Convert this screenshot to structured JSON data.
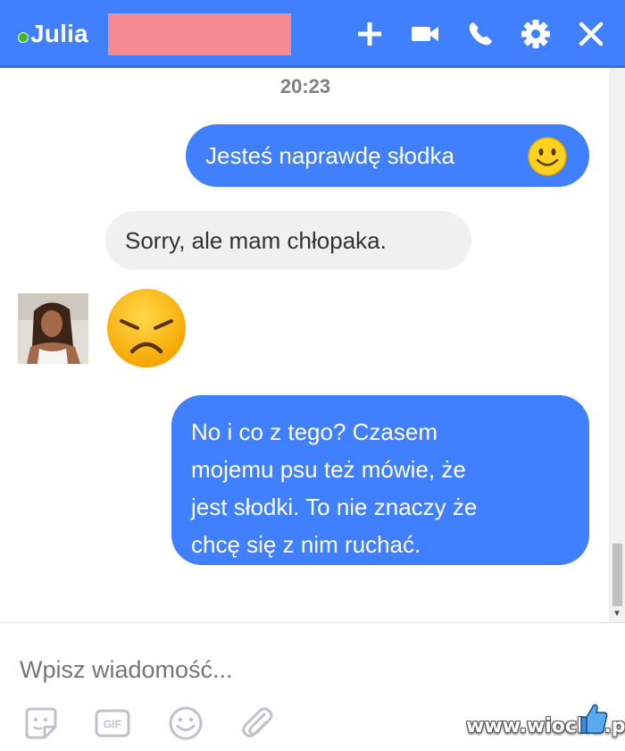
{
  "header": {
    "name": "Julia",
    "status_color": "#42b72a",
    "background": "#4080ff",
    "icons": [
      "plus-icon",
      "video-camera-icon",
      "phone-icon",
      "gear-icon",
      "close-icon"
    ]
  },
  "chat": {
    "timestamp": "20:23",
    "messages": [
      {
        "direction": "outgoing",
        "text": "Jesteś naprawdę słodka",
        "emoji": "smiling-face"
      },
      {
        "direction": "incoming",
        "text": "Sorry, ale mam chłopaka."
      },
      {
        "direction": "incoming",
        "emoji": "disappointed-face"
      },
      {
        "direction": "outgoing",
        "lines": [
          "No i co z tego? Czasem",
          "mojemu psu też mówie, że",
          "jest słodki. To nie znaczy że",
          "chcę się z nim ruchać."
        ]
      }
    ]
  },
  "composer": {
    "placeholder": "Wpisz wiadomość...",
    "tools": [
      "sticker-icon",
      "gif-icon",
      "emoji-icon",
      "attachment-icon"
    ],
    "gif_label": "GIF"
  },
  "watermark": "www.wiocha.pl"
}
